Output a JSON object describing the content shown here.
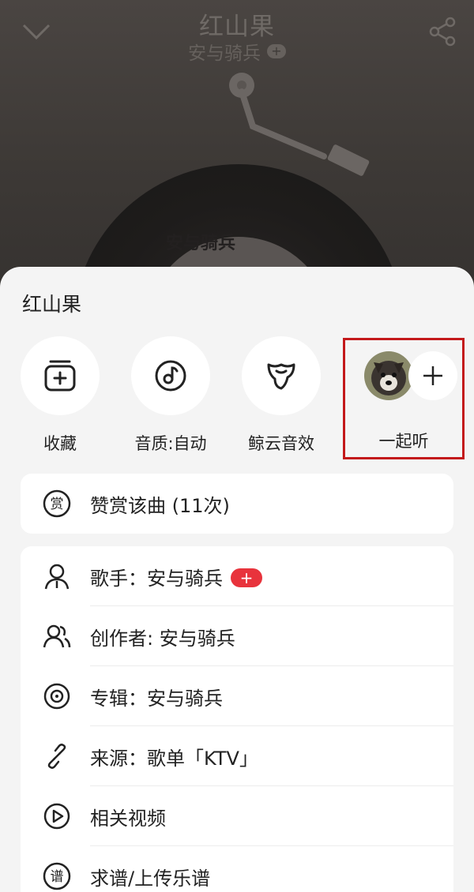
{
  "player": {
    "song_title": "红山果",
    "artist": "安与骑兵",
    "artist_follow_icon": "+",
    "disc_label_text": "安与骑兵",
    "icons": {
      "back": "chevron-down-icon",
      "share": "share-icon"
    }
  },
  "sheet": {
    "title": "红山果",
    "actions": [
      {
        "label": "收藏",
        "icon": "add-to-playlist-icon"
      },
      {
        "label": "音质:自动",
        "icon": "sound-quality-icon"
      },
      {
        "label": "鲸云音效",
        "icon": "whale-effect-icon"
      }
    ],
    "listen_together": {
      "label": "一起听",
      "plus": "+",
      "icon": "plus-icon"
    },
    "highlight_color": "#c3191b",
    "reward": {
      "label": "赞赏该曲 (11次)",
      "icon_char": "赏"
    },
    "rows": [
      {
        "label": "歌手：安与骑兵",
        "icon": "person-icon",
        "badge": "+"
      },
      {
        "label": "创作者: 安与骑兵",
        "icon": "people-icon"
      },
      {
        "label": "专辑：安与骑兵",
        "icon": "album-icon"
      },
      {
        "label": "来源：歌单「KTV」",
        "icon": "link-icon"
      },
      {
        "label": "相关视频",
        "icon": "video-icon"
      },
      {
        "label": "求谱/上传乐谱",
        "icon": "score-icon",
        "icon_char": "谱"
      }
    ]
  },
  "colors": {
    "badge": "#e8333c",
    "sheet_bg": "#f4f4f4"
  }
}
